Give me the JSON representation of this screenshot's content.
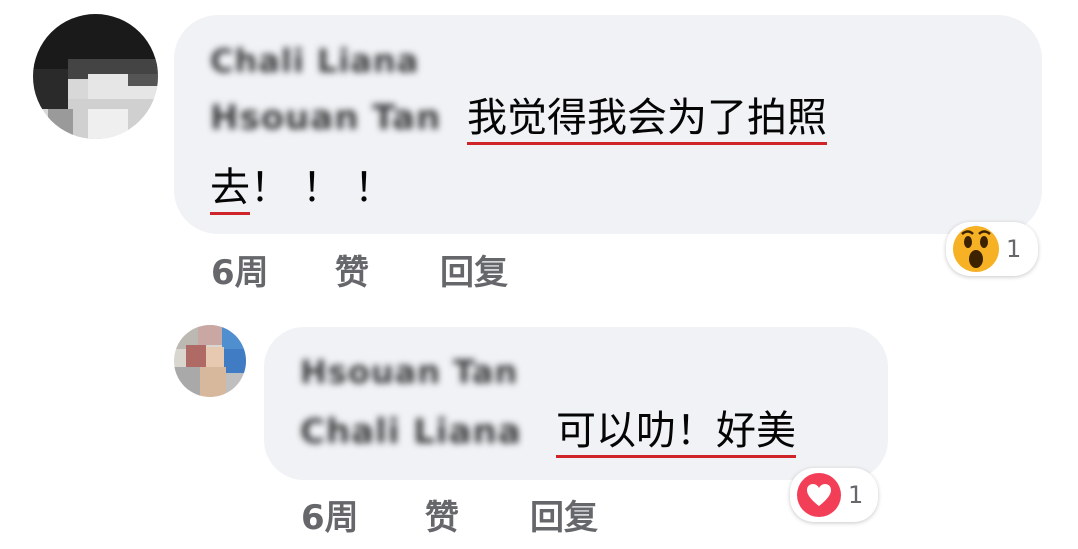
{
  "comments": [
    {
      "author": "Chali Liana",
      "mention": "Hsouan Tan",
      "text_line1": "我觉得我会为了拍照",
      "text_line2": "去",
      "text_line2_tail": "！！！",
      "time": "6周",
      "like_label": "赞",
      "reply_label": "回复",
      "reaction_icon": "wow-emoji-icon",
      "reaction_count": "1"
    },
    {
      "author": "Hsouan Tan",
      "mention": "Chali Liana",
      "text": "可以叻！好美",
      "time": "6周",
      "like_label": "赞",
      "reply_label": "回复",
      "reaction_icon": "love-heart-icon",
      "reaction_count": "1"
    }
  ],
  "colors": {
    "bubble": "#f0f2f5",
    "underline": "#d0242b",
    "meta_text": "#65676b",
    "love_red": "#f33e58",
    "wow_yellow": "#f7b125"
  }
}
